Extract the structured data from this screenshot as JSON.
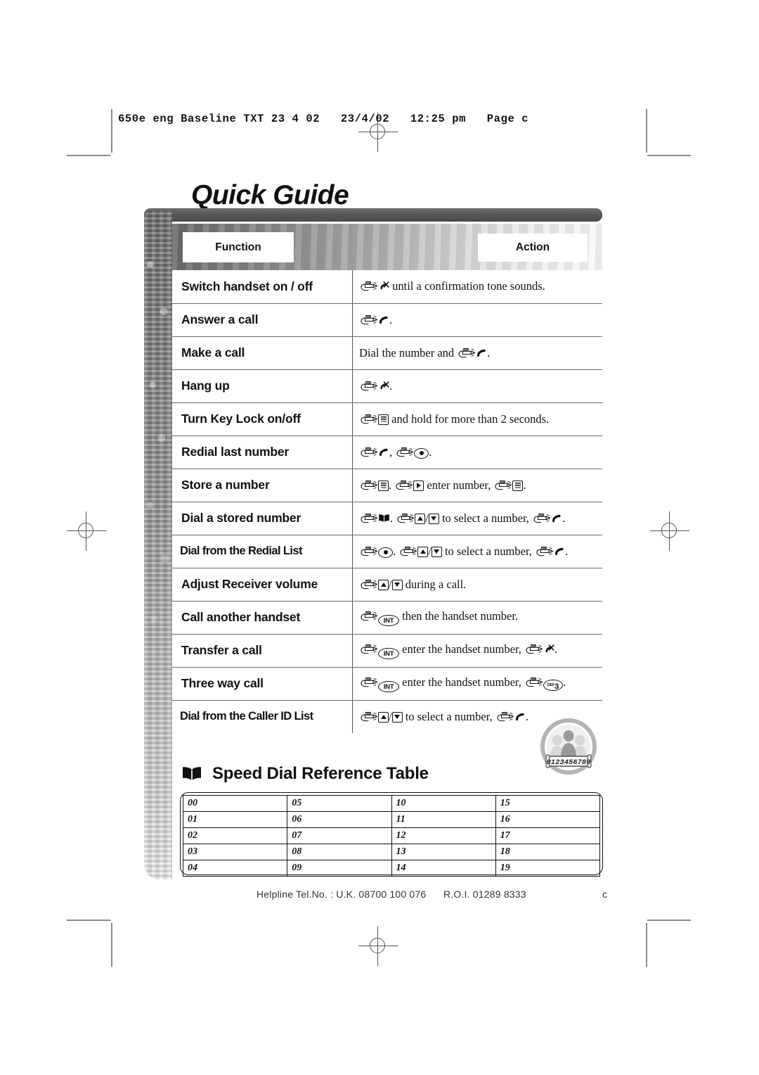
{
  "slug": "650e eng Baseline TXT 23 4 02   23/4/02   12:25 pm   Page c",
  "title": "Quick Guide",
  "table_header": {
    "function_label": "Function",
    "action_label": "Action"
  },
  "rows": [
    {
      "function": "Switch handset on / off",
      "action_text_1": "until a confirmation tone sounds."
    },
    {
      "function": "Answer a call",
      "action_text_1": "."
    },
    {
      "function": "Make a call",
      "action_text_0": "Dial the number and",
      "action_text_1": "."
    },
    {
      "function": "Hang up",
      "action_text_1": "."
    },
    {
      "function": "Turn Key Lock on/off",
      "action_text_1": "and hold for more than 2 seconds."
    },
    {
      "function": "Redial last number",
      "action_text_1": ",",
      "action_text_2": "."
    },
    {
      "function": "Store a number",
      "action_text_1": ".",
      "action_text_2": "enter number,",
      "action_text_3": "."
    },
    {
      "function": "Dial a stored number",
      "action_text_1": ".",
      "action_text_2": "to select a number,",
      "action_text_3": "."
    },
    {
      "function": "Dial from the Redial List",
      "action_text_1": ".",
      "action_text_2": "to select a number,",
      "action_text_3": "."
    },
    {
      "function": "Adjust Receiver volume",
      "action_text_1": "during a call."
    },
    {
      "function": "Call another handset",
      "action_text_1": "then the handset number."
    },
    {
      "function": "Transfer a call",
      "action_text_1": "enter the handset number,",
      "action_text_2": "."
    },
    {
      "function": "Three way call",
      "action_text_1": "enter the handset number,",
      "action_text_2": "."
    },
    {
      "function": "Dial from the Caller ID List",
      "action_text_1": "to select a number,",
      "action_text_2": "."
    }
  ],
  "speed_dial": {
    "title": "Speed Dial Reference Table",
    "grid": [
      [
        "00",
        "05",
        "10",
        "15"
      ],
      [
        "01",
        "06",
        "11",
        "16"
      ],
      [
        "02",
        "07",
        "12",
        "17"
      ],
      [
        "03",
        "08",
        "13",
        "18"
      ],
      [
        "04",
        "09",
        "14",
        "19"
      ]
    ]
  },
  "key_labels": {
    "int": "INT",
    "def": "DEF",
    "three": "3",
    "slash": "/"
  },
  "caller_id_badge": {
    "display_digits": "0123456789"
  },
  "footer": {
    "helpline": "Helpline Tel.No. : U.K. 08700 100 076      R.O.I. 01289 8333",
    "page_mark": "c"
  },
  "colors": {
    "ink": "#111111",
    "rule": "#6a6a6a",
    "band_dark": "#585858",
    "badge_gray": "#b8b8b8"
  }
}
